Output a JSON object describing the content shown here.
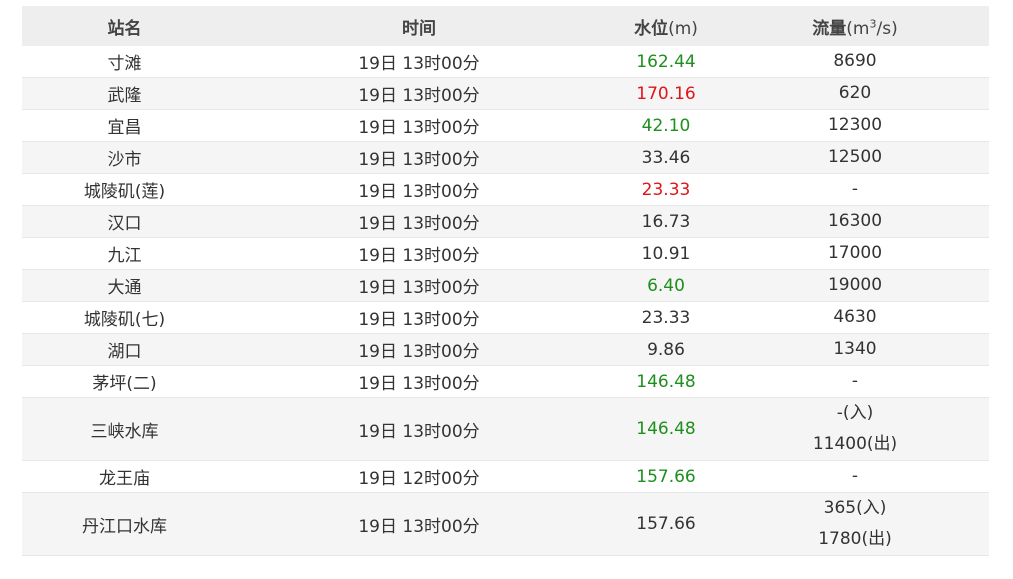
{
  "colors": {
    "green": "#1e8f1e",
    "red": "#e0141b",
    "normal": "#333333"
  },
  "headers": {
    "name": "站名",
    "time": "时间",
    "level": "水位",
    "level_unit": "(m)",
    "flow": "流量",
    "flow_unit_pre": "(m",
    "flow_unit_sup": "3",
    "flow_unit_post": "/s)"
  },
  "rows": [
    {
      "name": "寸滩",
      "time": "19日 13时00分",
      "level": "162.44",
      "level_color": "green",
      "flow": [
        "8690"
      ]
    },
    {
      "name": "武隆",
      "time": "19日 13时00分",
      "level": "170.16",
      "level_color": "red",
      "flow": [
        "620"
      ]
    },
    {
      "name": "宜昌",
      "time": "19日 13时00分",
      "level": "42.10",
      "level_color": "green",
      "flow": [
        "12300"
      ]
    },
    {
      "name": "沙市",
      "time": "19日 13时00分",
      "level": "33.46",
      "level_color": "normal",
      "flow": [
        "12500"
      ]
    },
    {
      "name": "城陵矶(莲)",
      "time": "19日 13时00分",
      "level": "23.33",
      "level_color": "red",
      "flow": [
        "-"
      ]
    },
    {
      "name": "汉口",
      "time": "19日 13时00分",
      "level": "16.73",
      "level_color": "normal",
      "flow": [
        "16300"
      ]
    },
    {
      "name": "九江",
      "time": "19日 13时00分",
      "level": "10.91",
      "level_color": "normal",
      "flow": [
        "17000"
      ]
    },
    {
      "name": "大通",
      "time": "19日 13时00分",
      "level": "6.40",
      "level_color": "green",
      "flow": [
        "19000"
      ]
    },
    {
      "name": "城陵矶(七)",
      "time": "19日 13时00分",
      "level": "23.33",
      "level_color": "normal",
      "flow": [
        "4630"
      ]
    },
    {
      "name": "湖口",
      "time": "19日 13时00分",
      "level": "9.86",
      "level_color": "normal",
      "flow": [
        "1340"
      ]
    },
    {
      "name": "茅坪(二)",
      "time": "19日 13时00分",
      "level": "146.48",
      "level_color": "green",
      "flow": [
        "-"
      ]
    },
    {
      "name": "三峡水库",
      "time": "19日 13时00分",
      "level": "146.48",
      "level_color": "green",
      "flow": [
        "-(入)",
        "11400(出)"
      ]
    },
    {
      "name": "龙王庙",
      "time": "19日 12时00分",
      "level": "157.66",
      "level_color": "green",
      "flow": [
        "-"
      ]
    },
    {
      "name": "丹江口水库",
      "time": "19日 13时00分",
      "level": "157.66",
      "level_color": "normal",
      "flow": [
        "365(入)",
        "1780(出)"
      ]
    }
  ]
}
